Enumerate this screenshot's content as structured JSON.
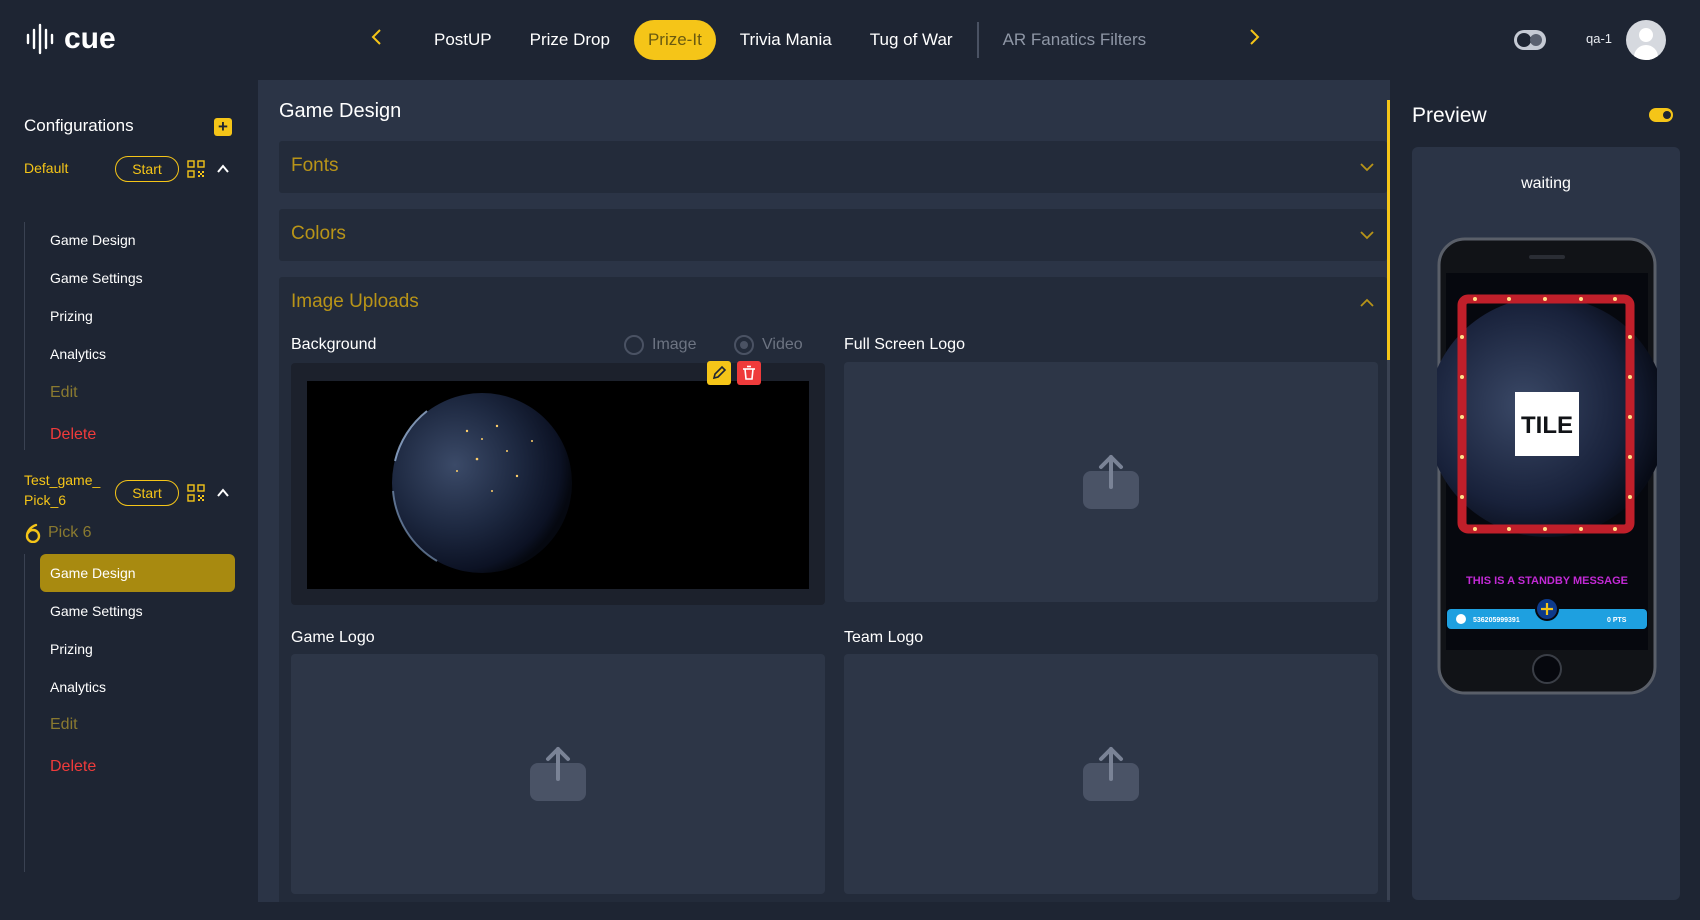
{
  "header": {
    "logo_text": "cue",
    "tabs": [
      {
        "label": "PostUP",
        "state": "normal"
      },
      {
        "label": "Prize Drop",
        "state": "normal"
      },
      {
        "label": "Prize-It",
        "state": "active"
      },
      {
        "label": "Trivia Mania",
        "state": "normal"
      },
      {
        "label": "Tug of War",
        "state": "normal"
      },
      {
        "label": "AR Fanatics Filters",
        "state": "dim"
      }
    ],
    "username": "qa-1"
  },
  "sidebar": {
    "title": "Configurations",
    "configs": [
      {
        "name": "Default",
        "start_label": "Start",
        "items": [
          "Game Design",
          "Game Settings",
          "Prizing",
          "Analytics"
        ],
        "edit_label": "Edit",
        "delete_label": "Delete"
      },
      {
        "name_line1": "Test_game_",
        "name_line2": "Pick_6",
        "start_label": "Start",
        "game_type": "Pick 6",
        "items": [
          "Game Design",
          "Game Settings",
          "Prizing",
          "Analytics"
        ],
        "active_item": "Game Design",
        "edit_label": "Edit",
        "delete_label": "Delete"
      }
    ]
  },
  "main": {
    "title": "Game Design",
    "sections": {
      "fonts": "Fonts",
      "colors": "Colors",
      "image_uploads": "Image Uploads"
    },
    "uploads": {
      "background": "Background",
      "radio_image": "Image",
      "radio_video": "Video",
      "radio_selected": "Video",
      "full_screen_logo": "Full Screen Logo",
      "game_logo": "Game Logo",
      "team_logo": "Team Logo"
    }
  },
  "preview": {
    "title": "Preview",
    "status": "waiting",
    "tile_text": "TILE",
    "standby_message": "THIS IS A STANDBY MESSAGE",
    "bar_id": "536205999391",
    "bar_pts": "0 PTS"
  },
  "colors": {
    "accent": "#f5c518",
    "background": "#1e2533",
    "panel": "#2b3446",
    "danger": "#ef3b3b"
  }
}
